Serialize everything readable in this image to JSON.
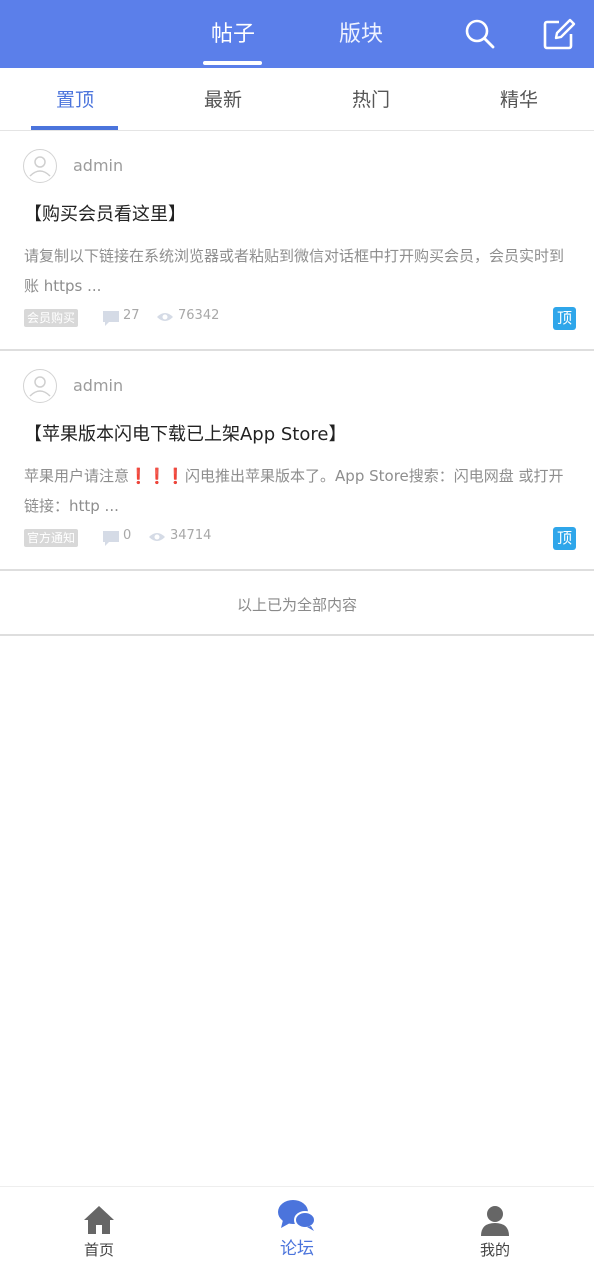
{
  "header": {
    "tabs": [
      "帖子",
      "版块"
    ],
    "active_tab": "帖子",
    "icons": [
      "search-icon",
      "compose-icon"
    ],
    "color": "#5b7fea"
  },
  "subtabs": [
    "置顶",
    "最新",
    "热门",
    "精华"
  ],
  "active_subtab": "置顶",
  "posts": [
    {
      "author": "admin",
      "title": "【购买会员看这里】",
      "excerpt": "请复制以下链接在系统浏览器或者粘贴到微信对话框中打开购买会员，会员实时到账 https ...",
      "tag": "会员购买",
      "comments": "27",
      "views": "76342",
      "badge": "顶"
    },
    {
      "author": "admin",
      "title": "【苹果版本闪电下载已上架App Store】",
      "excerpt_before": "苹果用户请注意",
      "excerpt_mark": "❗❗❗",
      "excerpt_after": "闪电推出苹果版本了。App Store搜索：闪电网盘 或打开链接：http ...",
      "tag": "官方通知",
      "comments": "0",
      "views": "34714",
      "badge": "顶"
    }
  ],
  "end_text": "以上已为全部内容",
  "bottom_nav": [
    {
      "label": "首页",
      "icon": "home-icon"
    },
    {
      "label": "论坛",
      "icon": "forum-icon",
      "active": true
    },
    {
      "label": "我的",
      "icon": "profile-icon"
    }
  ],
  "colors": {
    "accent": "#4b74dc",
    "badge": "#2fa6ea",
    "tag_bg": "#d8d8d8"
  }
}
